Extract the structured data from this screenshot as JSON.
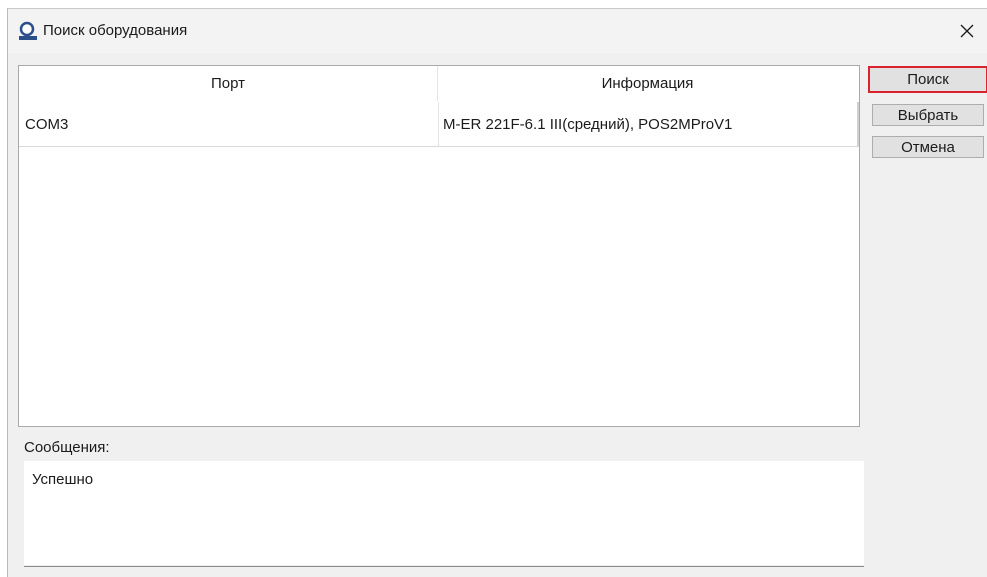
{
  "window": {
    "title": "Поиск оборудования",
    "close_symbol": "✕",
    "icon": "search-equipment-icon"
  },
  "table": {
    "columns": [
      "Порт",
      "Информация"
    ],
    "rows": [
      {
        "port": "COM3",
        "info": "M-ER 221F-6.1 III(средний), POS2MProV1"
      }
    ]
  },
  "buttons": {
    "search": "Поиск",
    "select": "Выбрать",
    "cancel": "Отмена"
  },
  "messages": {
    "label": "Сообщения:",
    "text": "Успешно"
  },
  "colors": {
    "focus_border": "#d9232e",
    "dialog_background": "#f0f0f0"
  }
}
